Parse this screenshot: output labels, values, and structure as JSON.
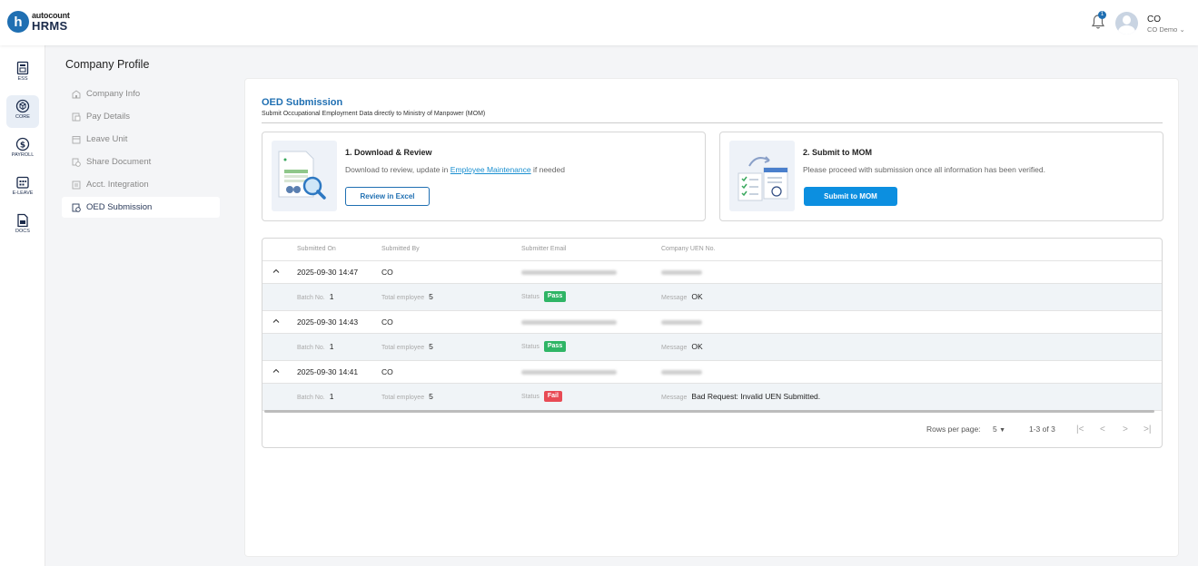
{
  "app": {
    "brand_top": "autocount",
    "brand_main": "HRMS",
    "logo_letter": "h",
    "notification_count": "1",
    "user_initials": "CO",
    "user_company": "CO Demo"
  },
  "rail": [
    {
      "label": "ESS",
      "icon": "ess-icon",
      "active": false
    },
    {
      "label": "CORE",
      "icon": "core-cube-icon",
      "active": true
    },
    {
      "label": "PAYROLL",
      "icon": "dollar-icon",
      "active": false
    },
    {
      "label": "E-LEAVE",
      "icon": "calendar-icon",
      "active": false
    },
    {
      "label": "DOCS",
      "icon": "document-icon",
      "active": false
    }
  ],
  "submenu": {
    "title": "Company Profile",
    "items": [
      {
        "label": "Company Info",
        "icon": "building-icon",
        "active": false
      },
      {
        "label": "Pay Details",
        "icon": "pay-icon",
        "active": false
      },
      {
        "label": "Leave Unit",
        "icon": "calendar-icon",
        "active": false
      },
      {
        "label": "Share Document",
        "icon": "share-icon",
        "active": false
      },
      {
        "label": "Acct. Integration",
        "icon": "integration-icon",
        "active": false
      },
      {
        "label": "OED Submission",
        "icon": "submission-icon",
        "active": true
      }
    ]
  },
  "page": {
    "title": "OED Submission",
    "subtitle": "Submit Occupational Employment Data directly to Ministry of Manpower (MOM)"
  },
  "cards": {
    "download": {
      "title": "1. Download & Review",
      "text_before": "Download to review, update in ",
      "link": "Employee Maintenance",
      "text_after": " if needed",
      "button": "Review in Excel"
    },
    "submit": {
      "title": "2. Submit to MOM",
      "text": "Please proceed with submission once all information has been verified.",
      "button": "Submit to MOM"
    }
  },
  "table": {
    "headers": {
      "submitted_on": "Submitted On",
      "submitted_by": "Submitted By",
      "email": "Submitter Email",
      "uen": "Company UEN No."
    },
    "detail_labels": {
      "batch": "Batch No.",
      "total": "Total employee",
      "status": "Status",
      "message": "Message"
    },
    "rows": [
      {
        "submitted_on": "2025-09-30 14:47",
        "submitted_by": "CO",
        "batch": "1",
        "total": "5",
        "status": "Pass",
        "message": "OK"
      },
      {
        "submitted_on": "2025-09-30 14:43",
        "submitted_by": "CO",
        "batch": "1",
        "total": "5",
        "status": "Pass",
        "message": "OK"
      },
      {
        "submitted_on": "2025-09-30 14:41",
        "submitted_by": "CO",
        "batch": "1",
        "total": "5",
        "status": "Fail",
        "message": "Bad Request: Invalid UEN Submitted."
      }
    ],
    "pagination": {
      "rows_per_page_label": "Rows per page:",
      "rows_per_page": "5",
      "range": "1-3 of 3"
    }
  },
  "colors": {
    "brand": "#1f6fb2",
    "primary_button": "#0c8fe0",
    "pass": "#2fb566",
    "fail": "#e84b55"
  }
}
